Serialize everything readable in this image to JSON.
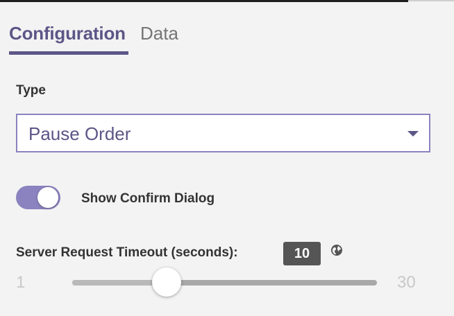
{
  "tabs": {
    "configuration": "Configuration",
    "data": "Data"
  },
  "type_field": {
    "label": "Type",
    "value": "Pause Order"
  },
  "confirm_toggle": {
    "label": "Show Confirm Dialog",
    "on": true
  },
  "timeout": {
    "label": "Server Request Timeout (seconds):",
    "value": "10",
    "min": "1",
    "max": "30"
  },
  "icons": {
    "globe": "globe-icon",
    "caret": "chevron-down-icon"
  },
  "colors": {
    "accent": "#5c5687",
    "accent_light": "#8a83bf",
    "badge": "#555555"
  }
}
